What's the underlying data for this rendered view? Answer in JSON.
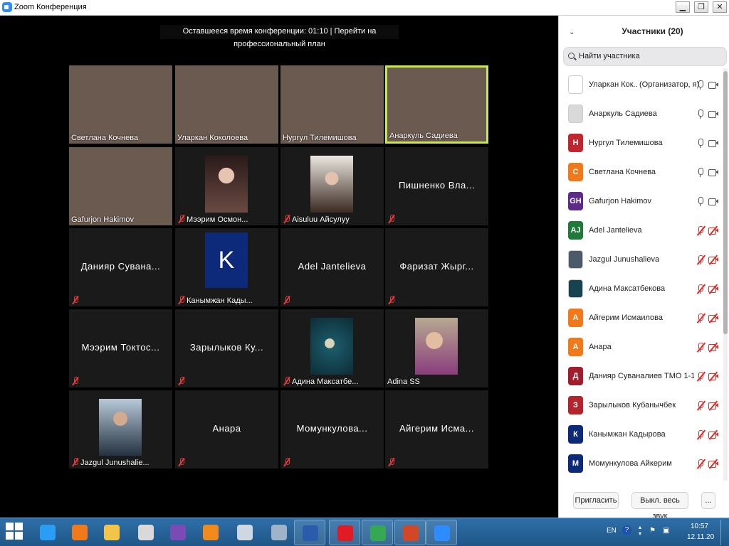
{
  "window": {
    "title": "Zoom Конференция",
    "minimize": "▁",
    "restore": "❐",
    "close": "✕"
  },
  "banner": "Оставшееся время конференции: 01:10 | Перейти на профессиональный план",
  "colors": {
    "active_speaker_border": "#c9e84c",
    "muted_red": "#e0302a",
    "taskbar": "#2e6fa8"
  },
  "tiles": [
    {
      "name": "Светлана Кочнева",
      "kind": "video"
    },
    {
      "name": "Уларкан Коколоева",
      "kind": "video"
    },
    {
      "name": "Нургул Тилемишова",
      "kind": "video"
    },
    {
      "name": "Анаркуль Садиева",
      "kind": "video",
      "active": true
    },
    {
      "name": "Gafurjon Hakimov",
      "kind": "video"
    },
    {
      "name": "Мээрим Осмон...",
      "kind": "photo",
      "muted": true
    },
    {
      "name": "Aisuluu Айсулуу",
      "kind": "photo",
      "muted": true
    },
    {
      "name": "Пишненко  Вла...",
      "kind": "name",
      "muted": true
    },
    {
      "name": "Данияр  Сувана...",
      "kind": "name",
      "muted": true
    },
    {
      "name": "Канымжан Кады...",
      "kind": "letter",
      "letter": "K",
      "muted": true
    },
    {
      "name": "Adel Jantelieva",
      "kind": "name",
      "muted": true
    },
    {
      "name": "Фаризат  Жырг...",
      "kind": "name",
      "muted": true
    },
    {
      "name": "Мээрим  Токтос...",
      "kind": "name",
      "muted": true
    },
    {
      "name": "Зарылыков  Ку...",
      "kind": "name",
      "muted": true
    },
    {
      "name": "Адина Максатбе...",
      "kind": "photo",
      "muted": true
    },
    {
      "name": "Adina SS",
      "kind": "photo",
      "muted": false
    },
    {
      "name": "Jazgul Junushalie...",
      "kind": "photo",
      "muted": true
    },
    {
      "name": "Анара",
      "kind": "name",
      "muted": true
    },
    {
      "name": "Момункулова...",
      "kind": "name",
      "muted": true
    },
    {
      "name": "Айгерим  Исма...",
      "kind": "name",
      "muted": true
    }
  ],
  "panel": {
    "collapse_icon": "⌄",
    "title": "Участники (20)",
    "search_placeholder": "Найти участника",
    "participants": [
      {
        "name": "Уларкан Кок...",
        "role": "(Организатор, я)",
        "avatar": "",
        "color": "#ffffff",
        "mic": "on",
        "cam": "on"
      },
      {
        "name": "Анаркуль Садиева",
        "role": "",
        "avatar": "",
        "color": "#d9d9d9",
        "mic": "on",
        "cam": "on"
      },
      {
        "name": "Нургул Тилемишова",
        "role": "",
        "avatar": "Н",
        "color": "#c0262f",
        "mic": "on",
        "cam": "on"
      },
      {
        "name": "Светлана Кочнева",
        "role": "",
        "avatar": "С",
        "color": "#f07a1a",
        "mic": "on",
        "cam": "on"
      },
      {
        "name": "Gafurjon Hakimov",
        "role": "",
        "avatar": "GH",
        "color": "#5e2a8a",
        "mic": "on",
        "cam": "on"
      },
      {
        "name": "Adel Jantelieva",
        "role": "",
        "avatar": "AJ",
        "color": "#1f7a3a",
        "mic": "muted",
        "cam": "off"
      },
      {
        "name": "Jazgul Junushalieva",
        "role": "",
        "avatar": "",
        "color": "#4a5a6a",
        "mic": "muted",
        "cam": "off"
      },
      {
        "name": "Адина Максатбекова",
        "role": "",
        "avatar": "",
        "color": "#17424f",
        "mic": "muted",
        "cam": "off"
      },
      {
        "name": "Айгерим Исмаилова",
        "role": "",
        "avatar": "А",
        "color": "#f07a1a",
        "mic": "muted",
        "cam": "off"
      },
      {
        "name": "Анара",
        "role": "",
        "avatar": "А",
        "color": "#f07a1a",
        "mic": "muted",
        "cam": "off"
      },
      {
        "name": "Данияр Суваналиев ТМО 1-17",
        "role": "",
        "avatar": "Д",
        "color": "#a11d2e",
        "mic": "muted",
        "cam": "off"
      },
      {
        "name": "Зарылыков Кубанычбек",
        "role": "",
        "avatar": "З",
        "color": "#b3242d",
        "mic": "muted",
        "cam": "off"
      },
      {
        "name": "Канымжан Кадырова",
        "role": "",
        "avatar": "К",
        "color": "#0d2a7a",
        "mic": "muted",
        "cam": "off"
      },
      {
        "name": "Момункулова Айкерим",
        "role": "",
        "avatar": "М",
        "color": "#0d2a7a",
        "mic": "muted",
        "cam": "off"
      }
    ],
    "invite": "Пригласить",
    "mute_all": "Выкл. весь звук",
    "more": "..."
  },
  "taskbar": {
    "apps": [
      {
        "icon": "internet-explorer-icon",
        "color": "#2a9df4",
        "open": false
      },
      {
        "icon": "media-player-icon",
        "color": "#f07a1a",
        "open": false
      },
      {
        "icon": "explorer-icon",
        "color": "#f3c44a",
        "open": false
      },
      {
        "icon": "scissors-icon",
        "color": "#d9d9d9",
        "open": false
      },
      {
        "icon": "visual-studio-icon",
        "color": "#7b4bb5",
        "open": false
      },
      {
        "icon": "avast-icon",
        "color": "#f08a1a",
        "open": false
      },
      {
        "icon": "audio-icon",
        "color": "#cfd8e2",
        "open": false
      },
      {
        "icon": "calculator-icon",
        "color": "#9fb4c8",
        "open": false
      },
      {
        "icon": "word-icon",
        "color": "#2b5cab",
        "open": true
      },
      {
        "icon": "opera-icon",
        "color": "#e01b24",
        "open": true
      },
      {
        "icon": "chrome-icon",
        "color": "#34a853",
        "open": true
      },
      {
        "icon": "powerpoint-icon",
        "color": "#d24726",
        "open": true
      },
      {
        "icon": "zoom-icon",
        "color": "#2d8cff",
        "open": true
      }
    ],
    "lang": "EN",
    "help": "?",
    "time": "10:57",
    "date": "12.11.20"
  }
}
